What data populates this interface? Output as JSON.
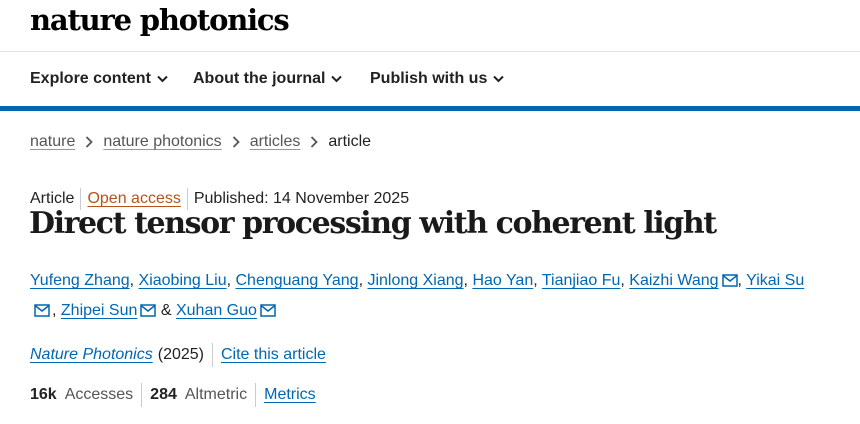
{
  "header": {
    "logo": "nature photonics"
  },
  "nav": {
    "items": [
      {
        "label": "Explore content"
      },
      {
        "label": "About the journal"
      },
      {
        "label": "Publish with us"
      }
    ],
    "accent": "#0067b1"
  },
  "breadcrumb": {
    "items": [
      "nature",
      "nature photonics",
      "articles"
    ],
    "current": "article"
  },
  "article": {
    "type": "Article",
    "access": "Open access",
    "published": "Published: 14 November 2025",
    "title": "Direct tensor processing with coherent light",
    "authors": [
      "Yufeng Zhang",
      "Xiaobing Liu",
      "Chenguang Yang",
      "Jinlong Xiang",
      "Hao Yan",
      "Tianjiao Fu",
      "Kaizhi Wang",
      "Yikai Su",
      "Zhipei Sun",
      "Xuhan Guo"
    ],
    "ampersand": "&",
    "journal": "Nature Photonics",
    "year": "(2025)",
    "cite": "Cite this article"
  },
  "metrics": {
    "accesses_value": "16k",
    "accesses_label": "Accesses",
    "altmetric_value": "284",
    "altmetric_label": "Altmetric",
    "link": "Metrics"
  },
  "icons": {
    "chevron": "chevron-down-icon",
    "separator": "chevron-right-icon",
    "mail": "mail-icon"
  }
}
